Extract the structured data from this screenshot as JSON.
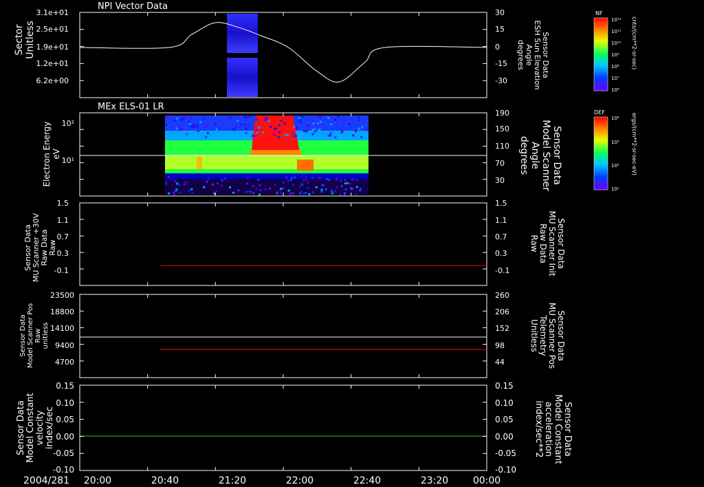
{
  "time_axis": {
    "date": "2004/281",
    "labels": [
      "20:00",
      "20:40",
      "21:20",
      "22:00",
      "22:40",
      "23:20",
      "00:00"
    ],
    "range_hours": [
      20,
      24
    ]
  },
  "colors": {
    "background": "#000000",
    "axis": "#ffffff",
    "red_trace": "#e01010",
    "green_trace": "#22cc22"
  },
  "panels": [
    {
      "id": "npi",
      "title": "NPI Vector Data",
      "left_label": [
        "Sector",
        "Unitless"
      ],
      "right_label": [
        "Sensor Data",
        "ESH Sun Elevation",
        "Angle",
        "degrees"
      ],
      "left_ticks": [
        "3.1e+01",
        "2.5e+01",
        "1.9e+01",
        "1.2e+01",
        "6.2e+00"
      ],
      "right_ticks": [
        "30",
        "15",
        "0",
        "-15",
        "-30"
      ],
      "colorbar": {
        "label": "NF",
        "unit": "cnts/(cm**2-sr-sec)",
        "ticks": [
          "10¹²",
          "10¹¹",
          "10¹⁰",
          "10⁹",
          "10⁸",
          "10⁷",
          "10⁶"
        ]
      }
    },
    {
      "id": "els",
      "title": "MEx ELS-01 LR",
      "left_label": [
        "Electron Energy",
        "eV"
      ],
      "right_label": [
        "Sensor Data",
        "Model Scanner",
        "Angle",
        "degrees"
      ],
      "left_ticks": [
        "10²",
        "10¹"
      ],
      "right_ticks": [
        "190",
        "150",
        "110",
        "70",
        "30"
      ],
      "colorbar": {
        "label": "DEF",
        "unit": "ergs/(cm**2-sr-sec-eV)",
        "ticks": [
          "10⁴",
          "10³",
          "10²",
          "10¹"
        ]
      }
    },
    {
      "id": "mu_raw",
      "title": "",
      "left_label": [
        "Sensor Data",
        "MU Scanner +30V",
        "Raw Data",
        "Raw"
      ],
      "right_label": [
        "Sensor Data",
        "MU Scanner Init",
        "Raw Data",
        "Raw"
      ],
      "left_ticks": [
        "1.5",
        "1.1",
        "0.7",
        "0.3",
        "-0.1"
      ],
      "right_ticks": [
        "1.5",
        "1.1",
        "0.7",
        "0.3",
        "-0.1"
      ]
    },
    {
      "id": "scanner_pos",
      "title": "",
      "left_label": [
        "Sensor Data",
        "Model Scanner Pos",
        "Raw",
        "unitless"
      ],
      "right_label": [
        "Sensor Data",
        "MU Scanner Pos",
        "Telemetry",
        "Unitless"
      ],
      "left_ticks": [
        "23500",
        "18800",
        "14100",
        "9400",
        "4700"
      ],
      "right_ticks": [
        "260",
        "206",
        "152",
        "98",
        "44"
      ]
    },
    {
      "id": "constant",
      "title": "",
      "left_label": [
        "Sensor Data",
        "Model Constant",
        "velocity",
        "index/sec"
      ],
      "right_label": [
        "Sensor Data",
        "Model Constant",
        "acceleration",
        "index/sec**2"
      ],
      "left_ticks": [
        "0.15",
        "0.10",
        "0.05",
        "0.00",
        "-0.05",
        "-0.10"
      ],
      "right_ticks": [
        "0.15",
        "0.10",
        "0.05",
        "0.00",
        "-0.05",
        "-0.10"
      ]
    }
  ],
  "chart_data": [
    {
      "type": "line",
      "panel": "npi",
      "series": [
        {
          "name": "",
          "x": [
            20.0,
            20.88,
            21.1,
            21.33,
            21.55,
            21.78,
            22.05,
            22.33,
            22.55,
            22.8,
            23.0,
            24.0
          ],
          "y": [
            0,
            0,
            12,
            23,
            19,
            11,
            0,
            -22,
            -32,
            -14,
            0,
            0
          ]
        }
      ],
      "spectrogram_band_hours": [
        21.33,
        21.67
      ],
      "ylim": [
        -40,
        30
      ]
    },
    {
      "type": "heatmap",
      "panel": "els",
      "data_range_hours": [
        20.73,
        22.77
      ],
      "reference_line_angle_deg": 90,
      "ylim": [
        0,
        190
      ]
    },
    {
      "type": "line",
      "panel": "mu_raw",
      "series": [
        {
          "name": "",
          "x": [
            20.7,
            24.0
          ],
          "y": [
            0.0,
            0.0
          ]
        }
      ],
      "ylim": [
        -0.3,
        1.5
      ]
    },
    {
      "type": "line",
      "panel": "scanner_pos",
      "series": [
        {
          "name": "",
          "x": [
            20.0,
            24.0
          ],
          "y": [
            11500,
            11500
          ]
        },
        {
          "name": "",
          "x": [
            20.7,
            24.0
          ],
          "y": [
            8200,
            8200
          ]
        }
      ],
      "ylim": [
        0,
        23500
      ]
    },
    {
      "type": "line",
      "panel": "constant",
      "series": [
        {
          "name": "",
          "x": [
            20.0,
            24.0
          ],
          "y": [
            0.0,
            0.0
          ]
        }
      ],
      "ylim": [
        -0.1,
        0.15
      ]
    }
  ]
}
